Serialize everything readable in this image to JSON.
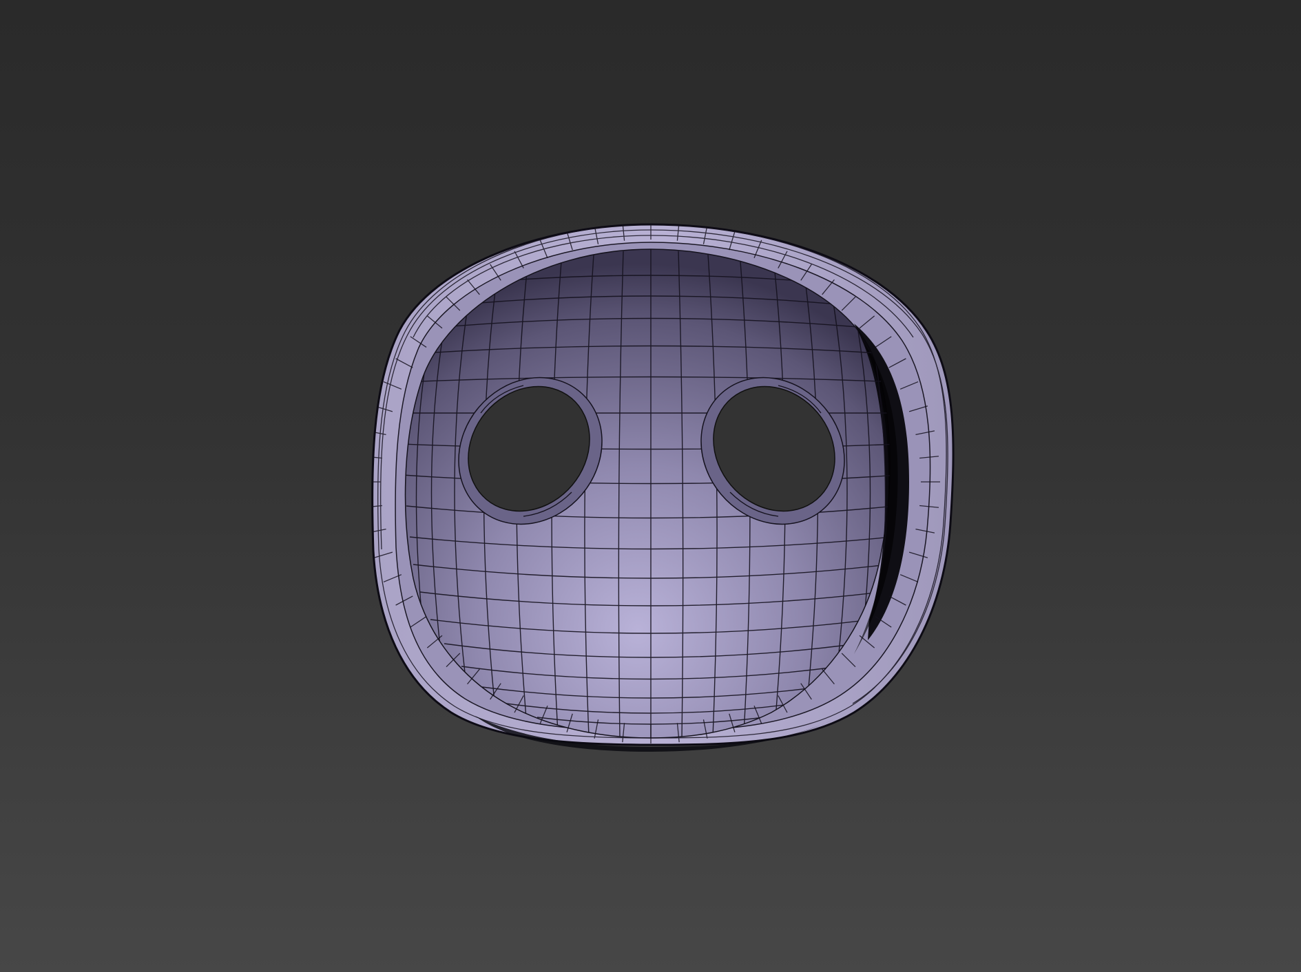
{
  "viewport": {
    "background_top": "#2a2a2a",
    "background_bottom": "#474747"
  },
  "model": {
    "object": "mask-mesh",
    "shading": "smooth-with-wireframe",
    "surface_color": "#8e86ae",
    "surface_light_color": "#b5aed2",
    "surface_dark_color": "#4a4460",
    "wire_color": "#121018"
  }
}
